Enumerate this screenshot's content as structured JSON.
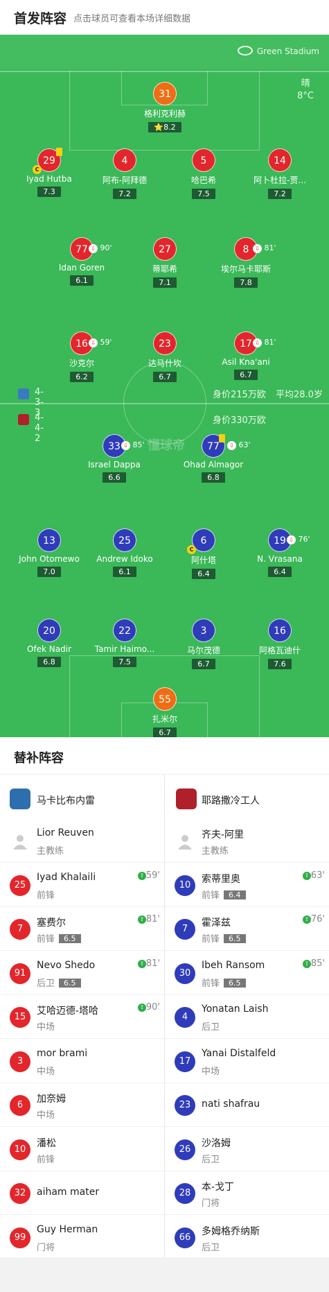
{
  "header": {
    "title": "首发阵容",
    "subtitle": "点击球员可查看本场详细数据"
  },
  "stadium": "Green Stadium",
  "weather": {
    "cond": "晴",
    "temp": "8°C"
  },
  "home": {
    "formation": "4-3-3",
    "value": "身价215万欧",
    "age": "平均28.0岁",
    "color": "#e2262c"
  },
  "away": {
    "formation": "4-4-2",
    "value": "身价330万欧",
    "color": "#2f3cba"
  },
  "watermark": "懂球帝",
  "home_players": [
    {
      "num": "31",
      "name": "格利克利赫",
      "rating": "⭐8.2",
      "kit": "orange"
    },
    {
      "num": "29",
      "name": "Iyad Hutba",
      "rating": "7.3",
      "kit": "red"
    },
    {
      "num": "4",
      "name": "阿布-阿拜德",
      "rating": "7.2",
      "kit": "red"
    },
    {
      "num": "5",
      "name": "哈巴希",
      "rating": "7.5",
      "kit": "red"
    },
    {
      "num": "14",
      "name": "阿卜杜拉-贾...",
      "rating": "7.2",
      "kit": "red"
    },
    {
      "num": "77",
      "name": "Idan Goren",
      "rating": "6.1",
      "kit": "red",
      "sub": "90'"
    },
    {
      "num": "27",
      "name": "蒂耶希",
      "rating": "7.1",
      "kit": "red"
    },
    {
      "num": "8",
      "name": "埃尔马卡耶斯",
      "rating": "7.8",
      "kit": "red",
      "sub": "81'"
    },
    {
      "num": "16",
      "name": "沙克尔",
      "rating": "6.2",
      "kit": "red",
      "sub": "59'"
    },
    {
      "num": "23",
      "name": "达马什坎",
      "rating": "6.7",
      "kit": "red"
    },
    {
      "num": "17",
      "name": "Asil Kna'ani",
      "rating": "6.7",
      "kit": "red",
      "sub": "81'"
    }
  ],
  "away_players": [
    {
      "num": "33",
      "name": "Israel Dappa",
      "rating": "6.6",
      "kit": "blue",
      "sub": "85'"
    },
    {
      "num": "77",
      "name": "Ohad Almagor",
      "rating": "6.8",
      "kit": "blue",
      "sub": "63'"
    },
    {
      "num": "13",
      "name": "John Otomewo",
      "rating": "7.0",
      "kit": "blue"
    },
    {
      "num": "25",
      "name": "Andrew Idoko",
      "rating": "6.1",
      "kit": "blue"
    },
    {
      "num": "6",
      "name": "阿什塔",
      "rating": "6.4",
      "kit": "blue"
    },
    {
      "num": "19",
      "name": "N. Vrasana",
      "rating": "6.4",
      "kit": "blue",
      "sub": "76'"
    },
    {
      "num": "20",
      "name": "Ofek Nadir",
      "rating": "6.8",
      "kit": "blue"
    },
    {
      "num": "22",
      "name": "Tamir Haimo...",
      "rating": "7.5",
      "kit": "blue"
    },
    {
      "num": "3",
      "name": "马尔茂德",
      "rating": "6.7",
      "kit": "blue"
    },
    {
      "num": "16",
      "name": "阿格瓦迪什",
      "rating": "7.6",
      "kit": "blue"
    },
    {
      "num": "55",
      "name": "扎米尔",
      "rating": "6.7",
      "kit": "orange"
    }
  ],
  "subs": {
    "title": "替补阵容",
    "home_team": "马卡比布内雷",
    "away_team": "耶路撒冷工人",
    "home": [
      {
        "num": "",
        "name": "Lior Reuven",
        "pos": "主教练",
        "coach": true
      },
      {
        "num": "25",
        "name": "Iyad Khalaili",
        "pos": "前锋",
        "rating": "",
        "in": "59'"
      },
      {
        "num": "7",
        "name": "塞费尔",
        "pos": "前锋",
        "rating": "6.5",
        "in": "81'"
      },
      {
        "num": "91",
        "name": "Nevo Shedo",
        "pos": "后卫",
        "rating": "6.5",
        "in": "81'"
      },
      {
        "num": "15",
        "name": "艾哈迈德-塔哈",
        "pos": "中场",
        "rating": "",
        "in": "90'"
      },
      {
        "num": "3",
        "name": "mor brami",
        "pos": "中场",
        "rating": "",
        "in": ""
      },
      {
        "num": "6",
        "name": "加奈姆",
        "pos": "中场",
        "rating": "",
        "in": ""
      },
      {
        "num": "10",
        "name": "潘松",
        "pos": "前锋",
        "rating": "",
        "in": ""
      },
      {
        "num": "32",
        "name": "aiham mater",
        "pos": "",
        "rating": "",
        "in": ""
      },
      {
        "num": "99",
        "name": "Guy Herman",
        "pos": "门将",
        "rating": "",
        "in": ""
      }
    ],
    "away": [
      {
        "num": "",
        "name": "齐夫-阿里",
        "pos": "主教练",
        "coach": true
      },
      {
        "num": "10",
        "name": "索蒂里奥",
        "pos": "前锋",
        "rating": "6.4",
        "in": "63'"
      },
      {
        "num": "7",
        "name": "霍泽兹",
        "pos": "前锋",
        "rating": "6.5",
        "in": "76'"
      },
      {
        "num": "30",
        "name": "Ibeh Ransom",
        "pos": "前锋",
        "rating": "6.5",
        "in": "85'"
      },
      {
        "num": "4",
        "name": "Yonatan Laish",
        "pos": "后卫",
        "rating": "",
        "in": ""
      },
      {
        "num": "17",
        "name": "Yanai Distalfeld",
        "pos": "中场",
        "rating": "",
        "in": ""
      },
      {
        "num": "23",
        "name": "nati shafrau",
        "pos": "",
        "rating": "",
        "in": ""
      },
      {
        "num": "26",
        "name": "沙洛姆",
        "pos": "后卫",
        "rating": "",
        "in": ""
      },
      {
        "num": "28",
        "name": "本-戈丁",
        "pos": "门将",
        "rating": "",
        "in": ""
      },
      {
        "num": "66",
        "name": "多姆格乔纳斯",
        "pos": "后卫",
        "rating": "",
        "in": ""
      }
    ]
  }
}
